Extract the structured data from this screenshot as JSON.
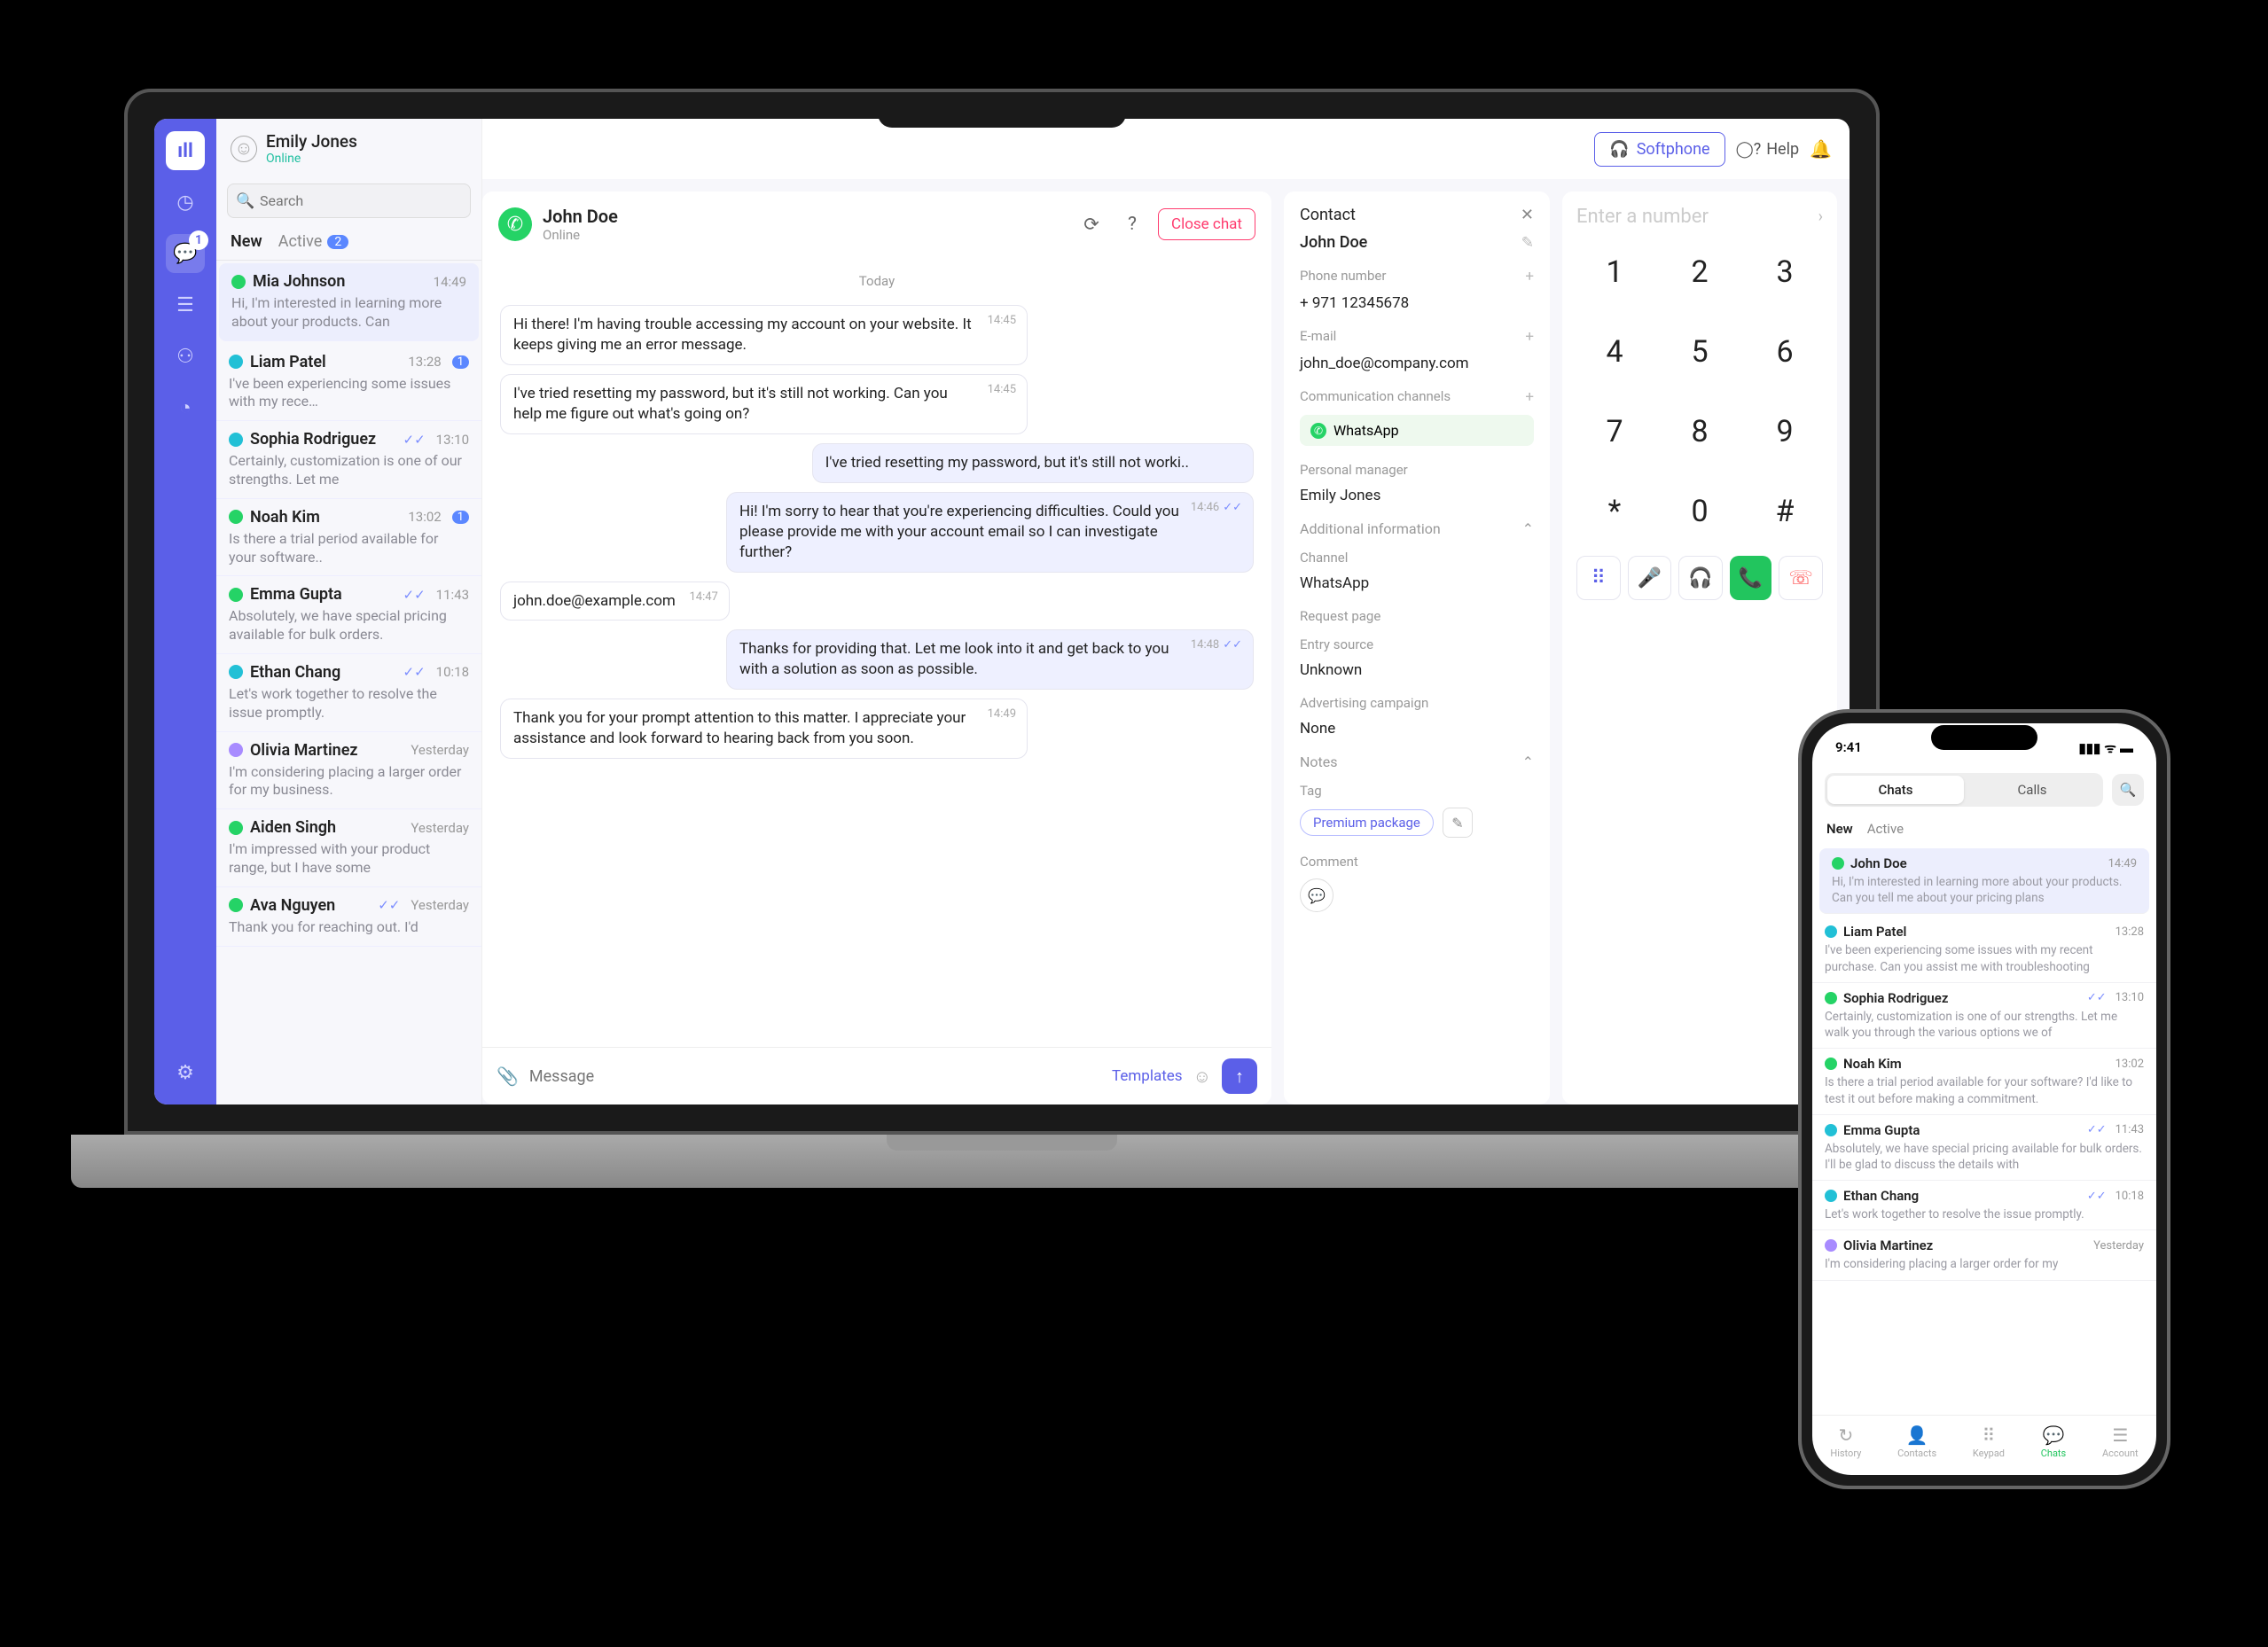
{
  "colors": {
    "primary": "#5b5fe8",
    "green": "#25d366",
    "accent_blue": "#5b87ff"
  },
  "header": {
    "user_name": "Emily Jones",
    "user_status": "Online",
    "softphone_label": "Softphone",
    "help_label": "Help"
  },
  "search": {
    "placeholder": "Search"
  },
  "tabs": {
    "new": "New",
    "active": "Active",
    "active_count": "2"
  },
  "rail": {
    "chat_badge": "1"
  },
  "chats": [
    {
      "name": "Mia Johnson",
      "time": "14:49",
      "dot": "#25d366",
      "preview": "Hi, I'm interested in learning more about your products. Can",
      "selected": true
    },
    {
      "name": "Liam Patel",
      "time": "13:28",
      "dot": "#22c0d6",
      "preview": "I've been experiencing some issues with my rece…",
      "badge": "1"
    },
    {
      "name": "Sophia Rodriguez",
      "time": "13:10",
      "dot": "#22c0d6",
      "preview": "Certainly, customization is one of our strengths. Let me",
      "check": true
    },
    {
      "name": "Noah Kim",
      "time": "13:02",
      "dot": "#25d366",
      "preview": "Is there a trial period available for your software..",
      "badge": "1"
    },
    {
      "name": "Emma Gupta",
      "time": "11:43",
      "dot": "#25d366",
      "preview": "Absolutely, we have special pricing available for bulk orders.",
      "check": true
    },
    {
      "name": "Ethan Chang",
      "time": "10:18",
      "dot": "#22c0d6",
      "preview": "Let's work together to resolve the issue promptly.",
      "check": true
    },
    {
      "name": "Olivia Martinez",
      "time": "Yesterday",
      "dot": "#a88bff",
      "preview": "I'm considering placing a larger order for my business."
    },
    {
      "name": "Aiden Singh",
      "time": "Yesterday",
      "dot": "#25d366",
      "preview": "I'm impressed with your product range, but I have some"
    },
    {
      "name": "Ava Nguyen",
      "time": "Yesterday",
      "dot": "#25d366",
      "preview": "Thank you for reaching out. I'd",
      "check": true
    }
  ],
  "conversation": {
    "name": "John Doe",
    "status": "Online",
    "close_label": "Close chat",
    "day": "Today",
    "messages": [
      {
        "dir": "in",
        "text": "Hi there! I'm having trouble accessing my account on your website. It keeps giving me an error message.",
        "time": "14:45"
      },
      {
        "dir": "in",
        "text": "I've tried resetting my password, but it's still not working. Can you help me figure out what's going on?",
        "time": "14:45"
      },
      {
        "dir": "out",
        "text": "I've tried resetting my password, but it's still not worki..",
        "time": ""
      },
      {
        "dir": "out",
        "text": "Hi! I'm sorry to hear that you're experiencing difficulties. Could you please provide me with your account email so I can investigate further?",
        "time": "14:46",
        "check": true
      },
      {
        "dir": "in",
        "text": "john.doe@example.com",
        "time": "14:47"
      },
      {
        "dir": "out",
        "text": "Thanks for providing that. Let me look into it and get back to you with a solution as soon as possible.",
        "time": "14:48",
        "check": true
      },
      {
        "dir": "in",
        "text": "Thank you for your prompt attention to this matter. I appreciate your assistance and look forward to hearing back from you soon.",
        "time": "14:49"
      }
    ],
    "compose_placeholder": "Message",
    "templates_label": "Templates"
  },
  "contact": {
    "title": "Contact",
    "name": "John Doe",
    "phone_lbl": "Phone number",
    "phone_val": "+ 971 12345678",
    "email_lbl": "E-mail",
    "email_val": "john_doe@company.com",
    "channels_lbl": "Communication channels",
    "channel_chip": "WhatsApp",
    "manager_lbl": "Personal manager",
    "manager_val": "Emily Jones",
    "addl_info_lbl": "Additional information",
    "channel_lbl": "Channel",
    "channel_val": "WhatsApp",
    "request_page_lbl": "Request page",
    "entry_source_lbl": "Entry source",
    "entry_source_val": "Unknown",
    "ad_campaign_lbl": "Advertising campaign",
    "ad_campaign_val": "None",
    "notes_lbl": "Notes",
    "tag_lbl": "Tag",
    "tag_val": "Premium package",
    "comment_lbl": "Comment"
  },
  "dialer": {
    "placeholder": "Enter a number",
    "keys": [
      "1",
      "2",
      "3",
      "4",
      "5",
      "6",
      "7",
      "8",
      "9",
      "*",
      "0",
      "#"
    ]
  },
  "phone": {
    "time": "9:41",
    "seg_chats": "Chats",
    "seg_calls": "Calls",
    "tabs_new": "New",
    "tabs_active": "Active",
    "items": [
      {
        "name": "John Doe",
        "time": "14:49",
        "dot": "#25d366",
        "preview": "Hi, I'm interested in learning more about your products. Can you tell me about your pricing plans",
        "selected": true
      },
      {
        "name": "Liam Patel",
        "time": "13:28",
        "dot": "#22c0d6",
        "preview": "I've been experiencing some issues with my recent purchase. Can you assist me with troubleshooting"
      },
      {
        "name": "Sophia Rodriguez",
        "time": "13:10",
        "dot": "#25d366",
        "preview": "Certainly, customization is one of our strengths. Let me walk you through the various options we of",
        "check": true
      },
      {
        "name": "Noah Kim",
        "time": "13:02",
        "dot": "#25d366",
        "preview": "Is there a trial period available for your software? I'd like to test it out before making a commitment."
      },
      {
        "name": "Emma Gupta",
        "time": "11:43",
        "dot": "#22c0d6",
        "preview": "Absolutely, we have special pricing available for bulk orders. I'll be glad to discuss the details with",
        "check": true
      },
      {
        "name": "Ethan Chang",
        "time": "10:18",
        "dot": "#22c0d6",
        "preview": "Let's work together to resolve the issue promptly.",
        "check": true
      },
      {
        "name": "Olivia Martinez",
        "time": "Yesterday",
        "dot": "#a88bff",
        "preview": "I'm considering placing a larger order for my"
      }
    ],
    "nav": [
      {
        "label": "History",
        "icon": "↻"
      },
      {
        "label": "Contacts",
        "icon": "👤"
      },
      {
        "label": "Keypad",
        "icon": "⠿"
      },
      {
        "label": "Chats",
        "icon": "💬",
        "active": true
      },
      {
        "label": "Account",
        "icon": "☰"
      }
    ]
  }
}
